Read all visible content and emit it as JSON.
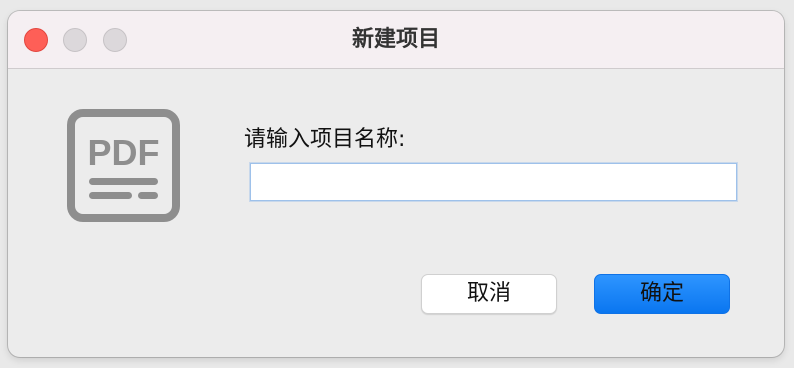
{
  "window": {
    "title": "新建项目"
  },
  "icon": {
    "name": "pdf-document-icon",
    "text": "PDF",
    "color": "#8e8e8e"
  },
  "form": {
    "prompt_label": "请输入项目名称:",
    "project_name_value": "",
    "input_border_color": "#9ec1ea"
  },
  "buttons": {
    "cancel_label": "取消",
    "confirm_label": "确定",
    "confirm_color": "#0a7aff"
  },
  "traffic_lights": {
    "close_color": "#fe5f57",
    "inactive_color": "#dcd8db"
  }
}
